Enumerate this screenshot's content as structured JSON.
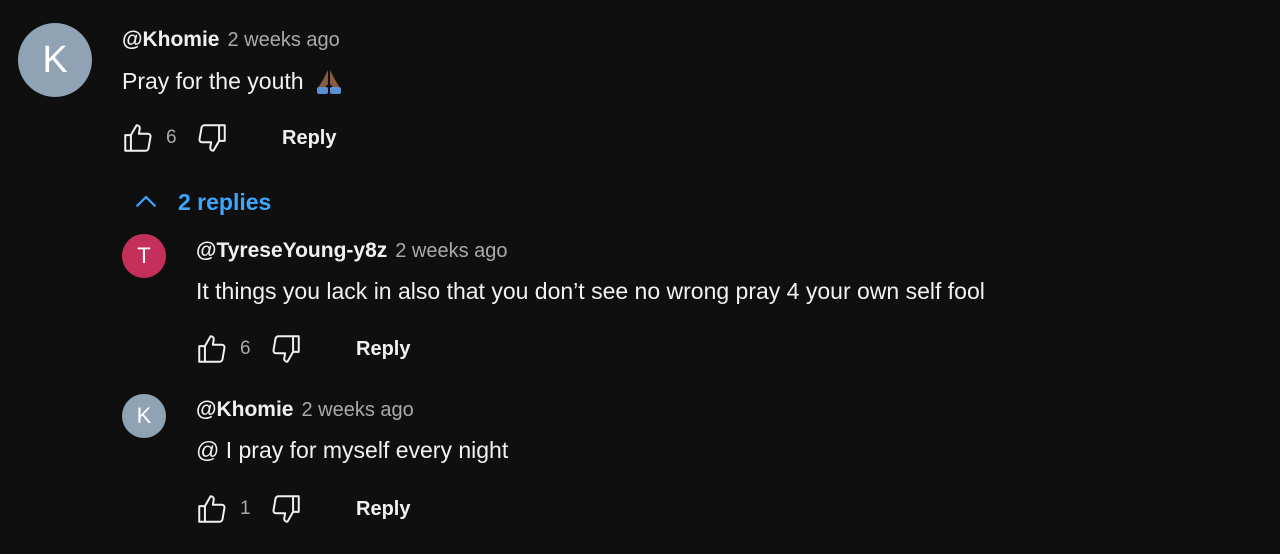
{
  "comments": [
    {
      "avatar_letter": "K",
      "avatar_color": "#8fa3b5",
      "author": "@Khomie",
      "time": "2 weeks ago",
      "text": "Pray for the youth",
      "emoji": "folded-hands-icon",
      "likes": "6",
      "reply_label": "Reply"
    }
  ],
  "replies_toggle": {
    "label": "2 replies",
    "icon": "chevron-up-icon",
    "color": "#3ea6ff"
  },
  "replies": [
    {
      "avatar_letter": "T",
      "avatar_color": "#c4305b",
      "author": "@TyreseYoung-y8z",
      "time": "2 weeks ago",
      "text": "It things you lack in also that you don’t see no wrong pray 4 your own self fool",
      "likes": "6",
      "reply_label": "Reply"
    },
    {
      "avatar_letter": "K",
      "avatar_color": "#8fa3b5",
      "author": "@Khomie",
      "time": "2 weeks ago",
      "text": "@ I pray for myself every night",
      "likes": "1",
      "reply_label": "Reply"
    }
  ]
}
